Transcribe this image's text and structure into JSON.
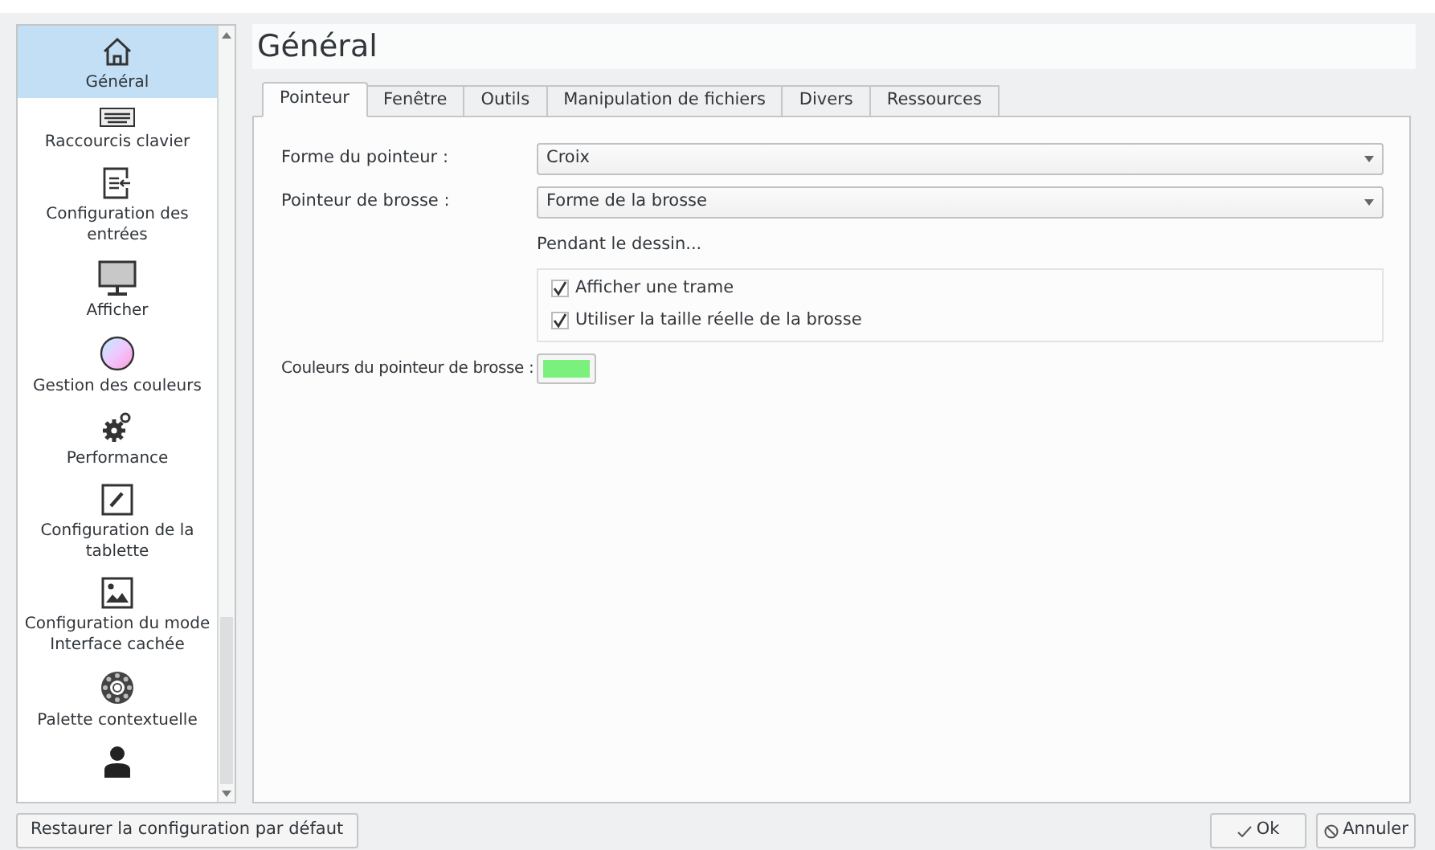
{
  "sidebar": {
    "items": [
      {
        "label": "Général",
        "kind": "house",
        "selected": true
      },
      {
        "label": "Raccourcis clavier",
        "kind": "keyboard",
        "selected": false
      },
      {
        "label": "Configuration des entrées",
        "kind": "input",
        "selected": false
      },
      {
        "label": "Afficher",
        "kind": "monitor",
        "selected": false
      },
      {
        "label": "Gestion des couleurs",
        "kind": "colorwheel",
        "selected": false
      },
      {
        "label": "Performance",
        "kind": "gears",
        "selected": false
      },
      {
        "label": "Configuration de la tablette",
        "kind": "pen",
        "selected": false
      },
      {
        "label": "Configuration du mode Interface cachée",
        "kind": "image",
        "selected": false
      },
      {
        "label": "Palette contextuelle",
        "kind": "ring",
        "selected": false
      },
      {
        "kind": "person",
        "selected": false
      }
    ]
  },
  "page_title": "Général",
  "tabs": [
    {
      "label": "Pointeur",
      "selected": true
    },
    {
      "label": "Fenêtre",
      "selected": false
    },
    {
      "label": "Outils",
      "selected": false
    },
    {
      "label": "Manipulation de fichiers",
      "selected": false
    },
    {
      "label": "Divers",
      "selected": false
    },
    {
      "label": "Ressources",
      "selected": false
    }
  ],
  "form": {
    "pointer_shape": {
      "label": "Forme du pointeur :",
      "value": "Croix"
    },
    "brush_pointer": {
      "label": "Pointeur de brosse :",
      "value": "Forme de la brosse"
    },
    "while_painting": {
      "label": "Pendant le dessin...",
      "options": [
        {
          "label": "Afficher une trame",
          "checked": true
        },
        {
          "label": "Utiliser la taille réelle de la brosse",
          "checked": true
        }
      ]
    },
    "brush_color": {
      "label": "Couleurs du pointeur de brosse :",
      "color": "#7cf07c"
    }
  },
  "footer": {
    "restore_button": "Restaurer la configuration par défaut",
    "ok_button": "Ok",
    "cancel_button": "Annuler"
  }
}
